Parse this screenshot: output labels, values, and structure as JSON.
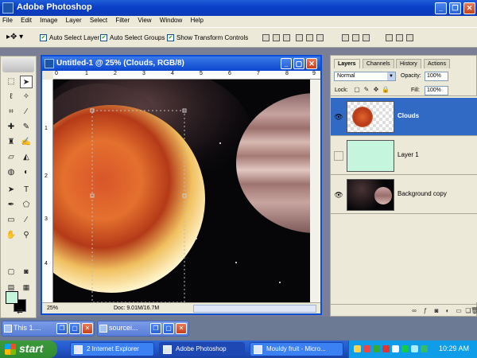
{
  "app": {
    "title": "Adobe Photoshop"
  },
  "menu": [
    "File",
    "Edit",
    "Image",
    "Layer",
    "Select",
    "Filter",
    "View",
    "Window",
    "Help"
  ],
  "options": {
    "auto_select_layer": "Auto Select Layer",
    "auto_select_groups": "Auto Select Groups",
    "show_transform_controls": "Show Transform Controls"
  },
  "document": {
    "title": "Untitled-1 @ 25% (Clouds, RGB/8)",
    "zoom": "25%",
    "doc_info": "Doc: 9.01M/16.7M",
    "ruler_top": [
      "0",
      "1",
      "2",
      "3",
      "4",
      "5",
      "6",
      "7",
      "8",
      "9"
    ],
    "ruler_left": [
      "1",
      "2",
      "3",
      "4"
    ]
  },
  "colors": {
    "foreground": "#c6f5dd",
    "background": "#000000"
  },
  "panel": {
    "tabs": [
      "Layers",
      "Channels",
      "History",
      "Actions"
    ],
    "blend_mode": "Normal",
    "opacity_label": "Opacity:",
    "opacity_value": "100%",
    "lock_label": "Lock:",
    "fill_label": "Fill:",
    "fill_value": "100%",
    "layers": [
      {
        "name": "Clouds",
        "visible": true,
        "selected": true
      },
      {
        "name": "Layer 1",
        "visible": false,
        "selected": false
      },
      {
        "name": "Background copy",
        "visible": true,
        "selected": false
      }
    ]
  },
  "minimized": [
    {
      "title": "This 1...."
    },
    {
      "title": "sourcei..."
    }
  ],
  "taskbar": {
    "start": "start",
    "tasks": [
      {
        "label": "2 Internet Explorer",
        "active": false
      },
      {
        "label": "Adobe Photoshop",
        "active": true
      },
      {
        "label": "Mouldy fruit - Micro...",
        "active": false
      }
    ],
    "clock": "10:29 AM"
  }
}
